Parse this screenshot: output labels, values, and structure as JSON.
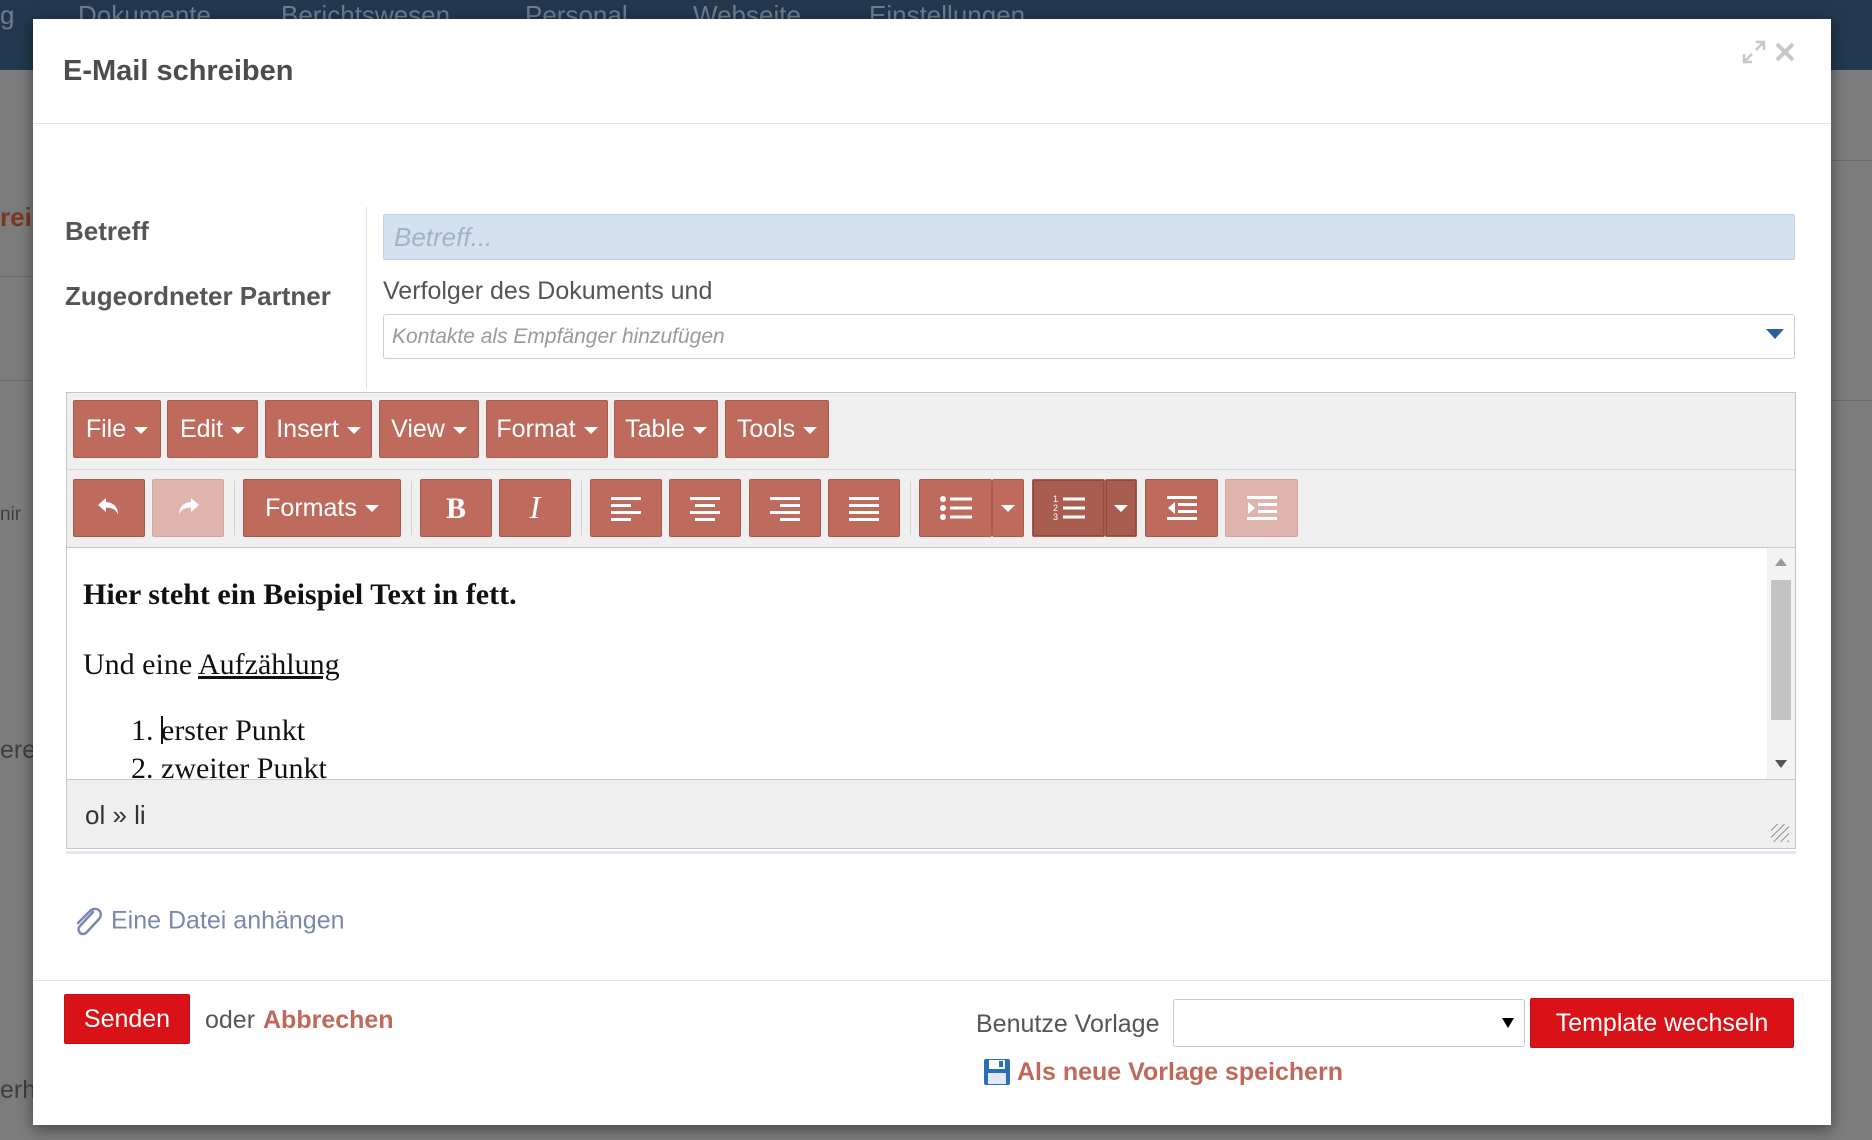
{
  "background": {
    "nav_items": [
      "g",
      "Dokumente",
      "Berichtswesen",
      "Personal",
      "Webseite",
      "Einstellungen"
    ],
    "side_texts": [
      "rei",
      "nir",
      "ere",
      "erh"
    ]
  },
  "modal": {
    "title": "E-Mail schreiben",
    "icons": [
      "expand-icon",
      "close-icon"
    ]
  },
  "form": {
    "subject_label": "Betreff",
    "subject_placeholder": "Betreff...",
    "partner_label": "Zugeordneter Partner",
    "partner_text": "Verfolger des Dokuments und",
    "contacts_placeholder": "Kontakte als Empfänger hinzufügen"
  },
  "editor": {
    "menu": [
      "File",
      "Edit",
      "Insert",
      "View",
      "Format",
      "Table",
      "Tools"
    ],
    "formats_label": "Formats",
    "content": {
      "bold_line": "Hier steht ein Beispiel Text in fett.",
      "line2_prefix": "Und eine ",
      "line2_underlined": "Aufzählung",
      "list_items": [
        "erster Punkt",
        "zweiter Punkt"
      ]
    },
    "status_path": "ol » li"
  },
  "attach_label": "Eine Datei anhängen",
  "footer": {
    "send_label": "Senden",
    "or_text": "oder",
    "cancel_label": "Abbrechen",
    "template_label": "Benutze Vorlage",
    "template_value": "",
    "switch_template_label": "Template wechseln",
    "save_template_label": "Als neue Vorlage speichern"
  },
  "colors": {
    "accent": "#be6b5d",
    "primary_button": "#d81217",
    "link": "#c0685a",
    "nav_bg": "#21384e"
  }
}
